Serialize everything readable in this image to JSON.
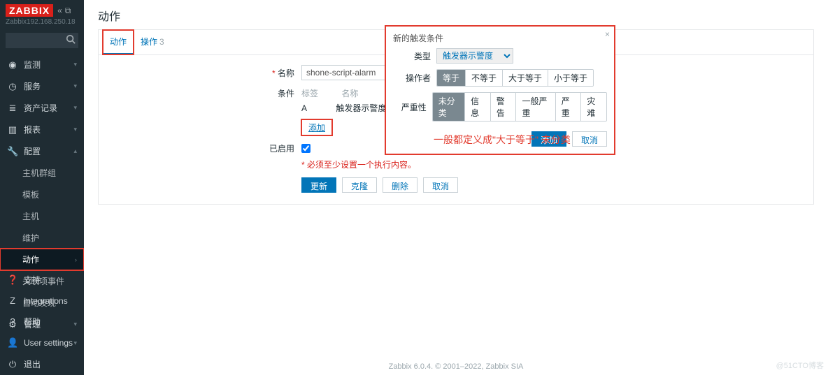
{
  "brand": "ZABBIX",
  "server_host": "Zabbix192.168.250.18",
  "search": {
    "placeholder": ""
  },
  "nav": {
    "monitoring": "监测",
    "services": "服务",
    "inventory": "资产记录",
    "reports": "报表",
    "config": "配置",
    "config_children": {
      "hostgroups": "主机群组",
      "templates": "模板",
      "hosts": "主机",
      "maintenance": "维护",
      "actions": "动作",
      "event_corr": "关联项事件",
      "discovery": "自动发现"
    },
    "admin": "管理",
    "support": "支持",
    "integrations": "Integrations",
    "help": "帮助",
    "user_settings": "User settings",
    "logout": "退出"
  },
  "page": {
    "title": "动作",
    "tabs": {
      "action": "动作",
      "operations": "操作",
      "operations_count": "3"
    },
    "form": {
      "name_label": "名称",
      "name_value": "shone-script-alarm",
      "cond_label": "条件",
      "cond_hd_tag": "标签",
      "cond_hd_name": "名称",
      "cond_key": "A",
      "cond_text": "触发器示警度 大于",
      "add_link": "添加",
      "enabled_label": "已启用",
      "warn_text": "必须至少设置一个执行内容。",
      "btn_update": "更新",
      "btn_clone": "克隆",
      "btn_delete": "删除",
      "btn_cancel": "取消"
    }
  },
  "modal": {
    "title": "新的触发条件",
    "type_label": "类型",
    "type_value": "触发器示警度",
    "operator_label": "操作者",
    "ops": {
      "eq": "等于",
      "neq": "不等于",
      "gte": "大于等于",
      "lte": "小于等于"
    },
    "severity_label": "严重性",
    "sev": {
      "ncl": "未分类",
      "info": "信息",
      "warn": "警告",
      "avg": "一般严重",
      "high": "严重",
      "dis": "灾难"
    },
    "btn_add": "添加",
    "btn_cancel": "取消"
  },
  "annotation": "一般都定义成\"大于等于\"  未分类",
  "footer": "Zabbix 6.0.4. © 2001–2022, Zabbix SIA",
  "watermark": "@51CTO博客"
}
